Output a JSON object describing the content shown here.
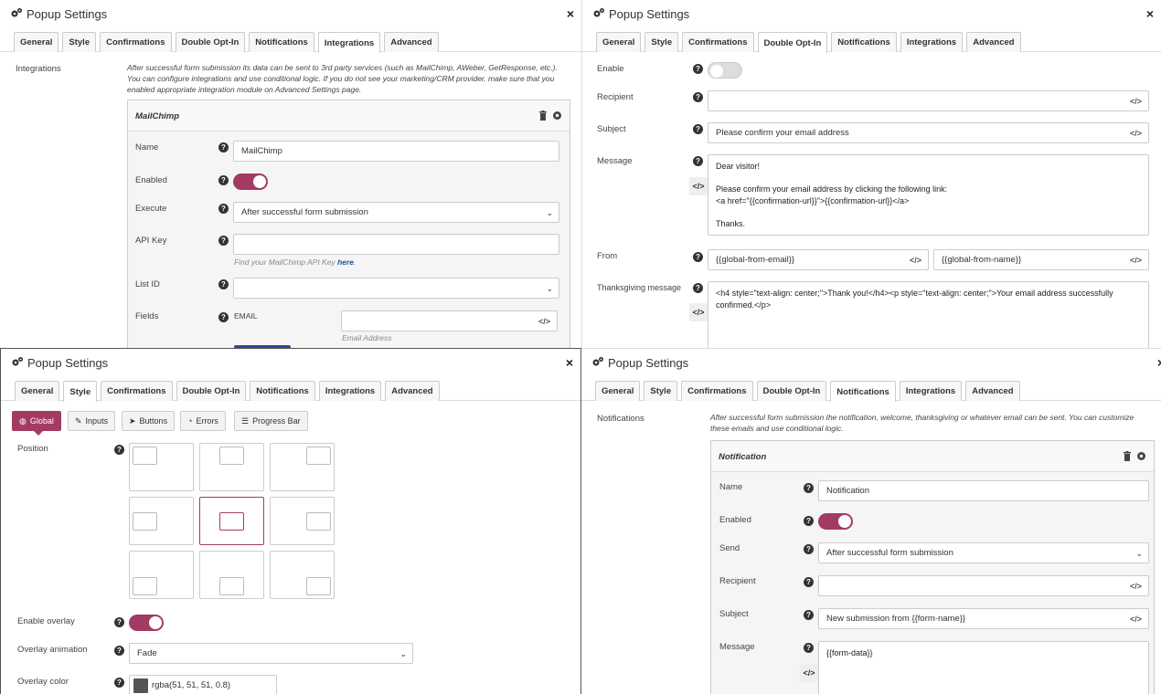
{
  "common": {
    "title": "Popup Settings",
    "tabs": [
      "General",
      "Style",
      "Confirmations",
      "Double Opt-In",
      "Notifications",
      "Integrations",
      "Advanced"
    ],
    "help_glyph": "?",
    "code_glyph": "</>",
    "close_glyph": "×"
  },
  "integrations": {
    "section_label": "Integrations",
    "description": "After successful form submission its data can be sent to 3rd party services (such as MailChimp, AWeber, GetResponse, etc.). You can configure integrations and use conditional logic. If you do not see your marketing/CRM provider, make sure that you enabled appropriate integration module on Advanced Settings page.",
    "box_title": "MailChimp",
    "name_label": "Name",
    "name_value": "MailChimp",
    "enabled_label": "Enabled",
    "execute_label": "Execute",
    "execute_value": "After successful form submission",
    "api_key_label": "API Key",
    "api_key_value": "",
    "api_hint": "Find your MailChimp API Key",
    "api_hint_link": "here",
    "list_id_label": "List ID",
    "fields_label": "Fields",
    "field_email": "EMAIL",
    "field_email_placeholder": "Email Address"
  },
  "double_opt_in": {
    "enable_label": "Enable",
    "recipient_label": "Recipient",
    "recipient_value": "",
    "subject_label": "Subject",
    "subject_value": "Please confirm your email address",
    "message_label": "Message",
    "message_value": "Dear visitor!\n\nPlease confirm your email address by clicking the following link:\n<a href=\"{{confirmation-url}}\">{{confirmation-url}}</a>\n\nThanks.",
    "from_label": "From",
    "from_email": "{{global-from-email}}",
    "from_name": "{{global-from-name}}",
    "thanks_label": "Thanksgiving message",
    "thanks_value": "<h4 style=\"text-align: center;\">Thank you!</h4><p style=\"text-align: center;\">Your email address successfully confirmed.</p>"
  },
  "style": {
    "subtabs": [
      "Global",
      "Inputs",
      "Buttons",
      "Errors",
      "Progress Bar"
    ],
    "position_label": "Position",
    "overlay_label": "Enable overlay",
    "overlay_anim_label": "Overlay animation",
    "overlay_anim_value": "Fade",
    "overlay_color_label": "Overlay color",
    "overlay_color_value": "rgba(51, 51, 51, 0.8)"
  },
  "notifications": {
    "section_label": "Notifications",
    "description": "After successful form submission the notification, welcome, thanksgiving or whatever email can be sent. You can customize these emails and use conditional logic.",
    "box_title": "Notification",
    "name_label": "Name",
    "name_value": "Notification",
    "enabled_label": "Enabled",
    "send_label": "Send",
    "send_value": "After successful form submission",
    "recipient_label": "Recipient",
    "recipient_value": "",
    "subject_label": "Subject",
    "subject_value": "New submission from {{form-name}}",
    "message_label": "Message",
    "message_value": "{{form-data}}"
  },
  "colors": {
    "accent": "#a33a63",
    "border": "#cccccc"
  }
}
